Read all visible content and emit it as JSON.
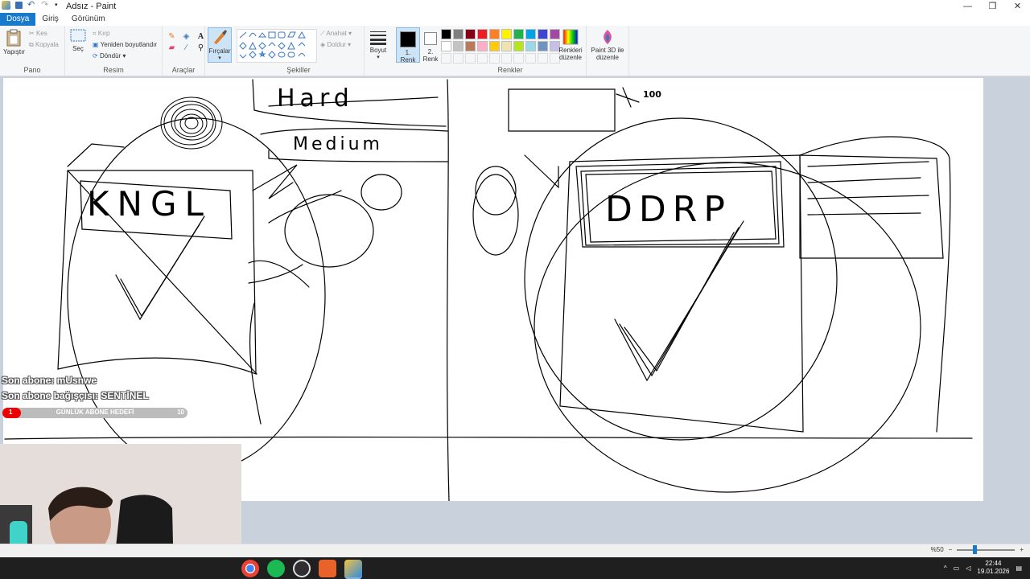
{
  "window": {
    "title": "Adsız - Paint",
    "minimize": "—",
    "maximize": "❐",
    "close": "✕"
  },
  "tabs": [
    "Dosya",
    "Giriş",
    "Görünüm"
  ],
  "ribbon": {
    "clipboard": {
      "paste": "Yapıştır",
      "cut": "Kes",
      "copy": "Kopyala",
      "group": "Pano"
    },
    "image": {
      "select": "Seç",
      "crop": "Kırp",
      "resize": "Yeniden boyutlandır",
      "rotate": "Döndür ▾",
      "group": "Resim"
    },
    "tools": {
      "group": "Araçlar"
    },
    "brushes": {
      "label": "Fırçalar"
    },
    "shapes": {
      "outline": "Anahat ▾",
      "fill": "Doldur ▾",
      "group": "Şekiller"
    },
    "size": {
      "label": "Boyut"
    },
    "colors": {
      "color1": "1. Renk",
      "color2": "2. Renk",
      "edit": "Renkleri düzenle",
      "paint3d": "Paint 3D ile düzenle",
      "group": "Renkler",
      "palette_row1": [
        "#000000",
        "#7f7f7f",
        "#880015",
        "#ed1c24",
        "#ff7f27",
        "#fff200",
        "#22b14c",
        "#00a2e8",
        "#3f48cc",
        "#a349a4"
      ],
      "palette_row2": [
        "#ffffff",
        "#c3c3c3",
        "#b97a57",
        "#ffaec9",
        "#ffc90e",
        "#efe4b0",
        "#b5e61d",
        "#99d9ea",
        "#7092be",
        "#c8bfe7"
      ]
    }
  },
  "drawing": {
    "labels": [
      "Hard",
      "Medium",
      "KNGL",
      "DDRP",
      "100"
    ]
  },
  "overlay": {
    "last_sub": "Son abone: mUsnwe",
    "last_gift": "Son abone bağışçısı: SENTİNEL",
    "goal_label": "GÜNLÜK ABONE HEDEFİ",
    "goal_current": "1",
    "goal_target": "10",
    "goal_progress": 0.1
  },
  "status": {
    "zoom": "%50",
    "zoom_minus": "−",
    "zoom_plus": "+"
  },
  "taskbar": {
    "time": "22:44",
    "date": "19.01.2026",
    "tray": "^"
  }
}
